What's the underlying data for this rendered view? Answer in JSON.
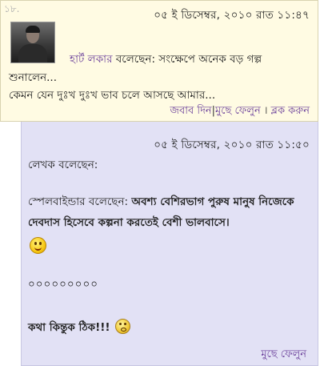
{
  "comment1": {
    "number": "১৮.",
    "date": "০৫ ই ডিসেম্বর, ২০১০ রাত ১১:৪৭",
    "author": "হার্ট লকার",
    "said": " বলেছেন: সংক্ষেপে অনেক বড় গল্প",
    "text_line2": "শুনালেন...",
    "text_line3": "কেমন যেন দুঃখ দুঃখ ভাব চলে আসছে আমার...",
    "actions": {
      "reply": "জবাব দিন",
      "separator1": "|",
      "delete": "মুছে ফেলুন",
      "separator2": "।",
      "block": "ব্লক করুন"
    }
  },
  "reply": {
    "date": "০৫ ই ডিসেম্বর, ২০১০ রাত ১১:৫০",
    "writer_said": "লেখক বলেছেন:",
    "quote_author": "স্পেলবাইন্ডার",
    "quote_said": " বলেছেন: ",
    "quote_text": "অবশ্য বেশিরভাগ পুরুষ মানুষ নিজেকে দেবদাস হিসেবে কল্পনা করতেই বেশী ভালবাসে।",
    "dots": "০০০০০০০০০",
    "bold_text": "কথা কিন্তুক ঠিক!!!",
    "delete": "মুছে ফেলুন",
    "icons": [
      "smile-emoticon",
      "sweat-emoticon"
    ]
  },
  "colors": {
    "comment_bg": "#fffbe3",
    "reply_bg": "#e2e1f5",
    "link": "#6a3f9a"
  }
}
